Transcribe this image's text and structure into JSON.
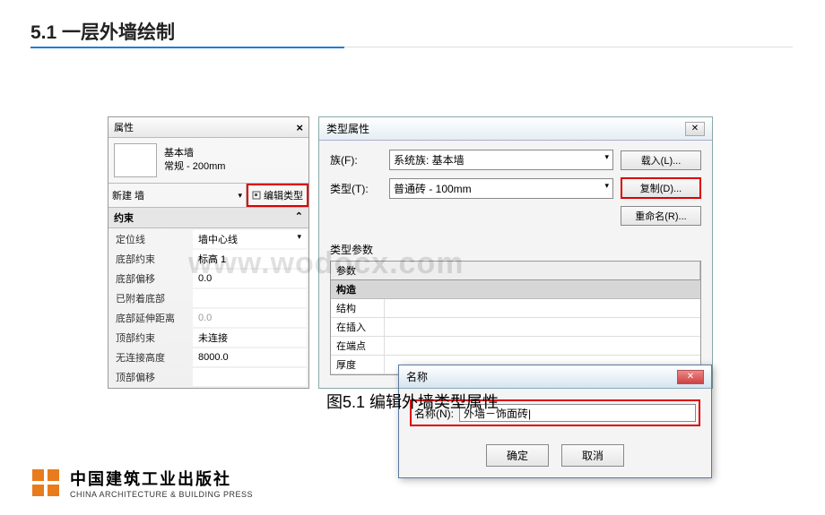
{
  "heading": "5.1 一层外墙绘制",
  "caption": "图5.1 编辑外墙类型属性",
  "watermark": "www.wodocx.com",
  "prop": {
    "title": "属性",
    "wall_family": "基本墙",
    "wall_type": "常规 - 200mm",
    "new_wall": "新建 墙",
    "edit_type": "编辑类型",
    "section": "约束",
    "rows": [
      {
        "label": "定位线",
        "value": "墙中心线",
        "dd": true
      },
      {
        "label": "底部约束",
        "value": "标高 1"
      },
      {
        "label": "底部偏移",
        "value": "0.0"
      },
      {
        "label": "已附着底部",
        "value": "",
        "grey": true
      },
      {
        "label": "底部延伸距离",
        "value": "0.0",
        "grey": true
      },
      {
        "label": "顶部约束",
        "value": "未连接"
      },
      {
        "label": "无连接高度",
        "value": "8000.0"
      },
      {
        "label": "顶部偏移",
        "value": ""
      }
    ]
  },
  "type_dlg": {
    "title": "类型属性",
    "family_label": "族(F):",
    "family_value": "系统族: 基本墙",
    "type_label": "类型(T):",
    "type_value": "普通砖 - 100mm",
    "load_btn": "载入(L)...",
    "copy_btn": "复制(D)...",
    "rename_btn": "重命名(R)...",
    "params_label": "类型参数",
    "thead1": "参数",
    "section1": "构造",
    "grid_rows": [
      {
        "c1": "结构",
        "c2": ""
      },
      {
        "c1": "在插入",
        "c2": ""
      },
      {
        "c1": "在端点",
        "c2": ""
      },
      {
        "c1": "厚度",
        "c2": ""
      }
    ]
  },
  "name_dlg": {
    "title": "名称",
    "label": "名称(N):",
    "value": "外墙－饰面砖|",
    "ok": "确定",
    "cancel": "取消"
  },
  "footer": {
    "cn": "中国建筑工业出版社",
    "en": "CHINA ARCHITECTURE & BUILDING PRESS"
  }
}
